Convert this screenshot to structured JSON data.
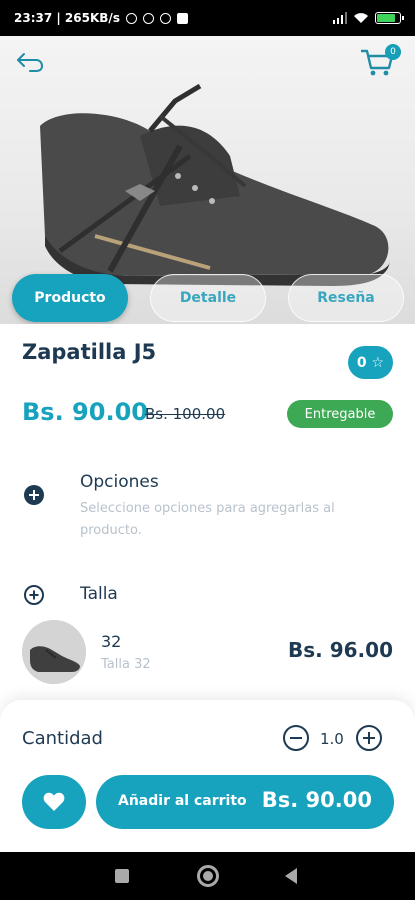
{
  "status_bar": {
    "time_info": "23:37 | 265KB/s"
  },
  "header": {
    "back_icon": "back-arrow-icon",
    "cart_icon": "shopping-cart-icon",
    "cart_count": "0"
  },
  "tabs": [
    {
      "label": "Producto",
      "active": true
    },
    {
      "label": "Detalle",
      "active": false
    },
    {
      "label": "Reseña",
      "active": false
    }
  ],
  "product": {
    "name": "Zapatilla J5",
    "rating": "0 ☆",
    "price": "Bs. 90.00",
    "old_price": "Bs. 100.00",
    "status_badge": "Entregable"
  },
  "options": {
    "title": "Opciones",
    "description": "Seleccione opciones para agregarlas al producto."
  },
  "size": {
    "title": "Talla",
    "variant_name": "32",
    "variant_sub": "Talla 32",
    "variant_price": "Bs. 96.00"
  },
  "bottom": {
    "qty_label": "Cantidad",
    "qty_value": "1.0",
    "add_label": "Añadir al carrito",
    "add_price": "Bs. 90.00"
  },
  "colors": {
    "accent": "#17a2bd",
    "text_dark": "#1e3a52",
    "badge_green": "#3ea955",
    "muted": "#b8c2cc"
  }
}
